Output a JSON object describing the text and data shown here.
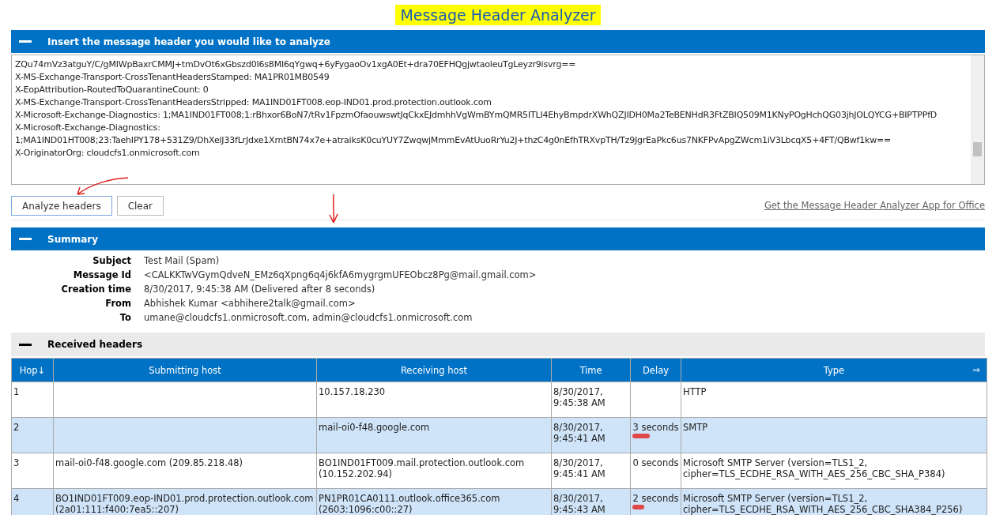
{
  "title": "Message Header Analyzer",
  "input_section": {
    "heading": "Insert the message header you would like to analyze",
    "lines": [
      "ZQu74mVz3atguY/C/gMIWpBaxrCMMJ+tmDvOt6xGbszd0I6s8MI6qYgwq+6yFygaoOv1xgA0Et+dra70EFHQgjwtaoleuTgLeyzr9isvrg==",
      "X-MS-Exchange-Transport-CrossTenantHeadersStamped: MA1PR01MB0549",
      "X-EopAttribution-RoutedToQuarantineCount: 0",
      "X-MS-Exchange-Transport-CrossTenantHeadersStripped: MA1IND01FT008.eop-IND01.prod.protection.outlook.com",
      "X-Microsoft-Exchange-Diagnostics: 1;MA1IND01FT008;1:rBhxor6BoN7/tRv1FpzmOfaouwswtJqCkxEJdmhhVgWmBYmQMR5ITLI4EhyBmpdrXWhQZJIDH0Ma2TeBENHdR3FtZBIQ509M1KNyPOgHchQG03jhJOLQYCG+BIPTPPfD",
      "X-Microsoft-Exchange-Diagnostics:",
      "1;MA1IND01HT008;23:TaehIPY178+531Z9/DhXelJ33fLrJdxe1XrntBN74x7e+atraiksK0cuYUY7ZwqwjMmmEvAtUuoRrYu2J+thzC4g0nEfhTRXvpTH/Tz9JgrEaPkc6us7NKFPvApgZWcm1iV3LbcqX5+4FT/QBwf1kw==",
      "X-OriginatorOrg: cloudcfs1.onmicrosoft.com"
    ]
  },
  "buttons": [
    "Analyze headers",
    "Clear"
  ],
  "app_link": "Get the Message Header Analyzer App for Office",
  "summary": {
    "heading": "Summary",
    "fields": [
      {
        "label": "Subject",
        "value": "Test Mail (Spam)"
      },
      {
        "label": "Message Id",
        "value": "<CALKKTwVGymQdveN_EMz6qXpng6q4j6kfA6mygrgmUFEObcz8Pg@mail.gmail.com>"
      },
      {
        "label": "Creation time",
        "value": "8/30/2017, 9:45:38 AM (Delivered after 8 seconds)"
      },
      {
        "label": "From",
        "value": "Abhishek Kumar <abhihere2talk@gmail.com>"
      },
      {
        "label": "To",
        "value": "umane@cloudcfs1.onmicrosoft.com, admin@cloudcfs1.onmicrosoft.com"
      }
    ]
  },
  "received_headers": {
    "heading": "Received headers",
    "columns": [
      "Hop↓",
      "Submitting host",
      "Receiving host",
      "Time",
      "Delay",
      "Type"
    ],
    "expand_glyph": "⇒",
    "rows": [
      {
        "hop": "1",
        "submitting_host": "",
        "receiving_host": "10.157.18.230",
        "time": "8/30/2017, 9:45:38 AM",
        "type": "HTTP"
      },
      {
        "hop": "2",
        "submitting_host": "",
        "receiving_host": "mail-oi0-f48.google.com",
        "time": "8/30/2017, 9:45:41 AM",
        "delay": "3 seconds",
        "level": 0.375,
        "type": "SMTP"
      },
      {
        "hop": "3",
        "submitting_host": "mail-oi0-f48.google.com (209.85.218.48)",
        "receiving_host": "BO1IND01FT009.mail.protection.outlook.com (10.152.202.94)",
        "time": "8/30/2017, 9:45:41 AM",
        "delay": "0 seconds",
        "level": 0,
        "type": "Microsoft SMTP Server (version=TLS1_2, cipher=TLS_ECDHE_RSA_WITH_AES_256_CBC_SHA_P384)"
      },
      {
        "hop": "4",
        "submitting_host": "BO1IND01FT009.eop-IND01.prod.protection.outlook.com (2a01:111:f400:7ea5::207)",
        "receiving_host": "PN1PR01CA0111.outlook.office365.com (2603:1096:c00::27)",
        "time": "8/30/2017, 9:45:43 AM",
        "delay": "2 seconds",
        "level": 0.25,
        "type": "Microsoft SMTP Server (version=TLS1_2, cipher=TLS_ECDHE_RSA_WITH_AES_256_CBC_SHA384_P256)"
      }
    ]
  }
}
